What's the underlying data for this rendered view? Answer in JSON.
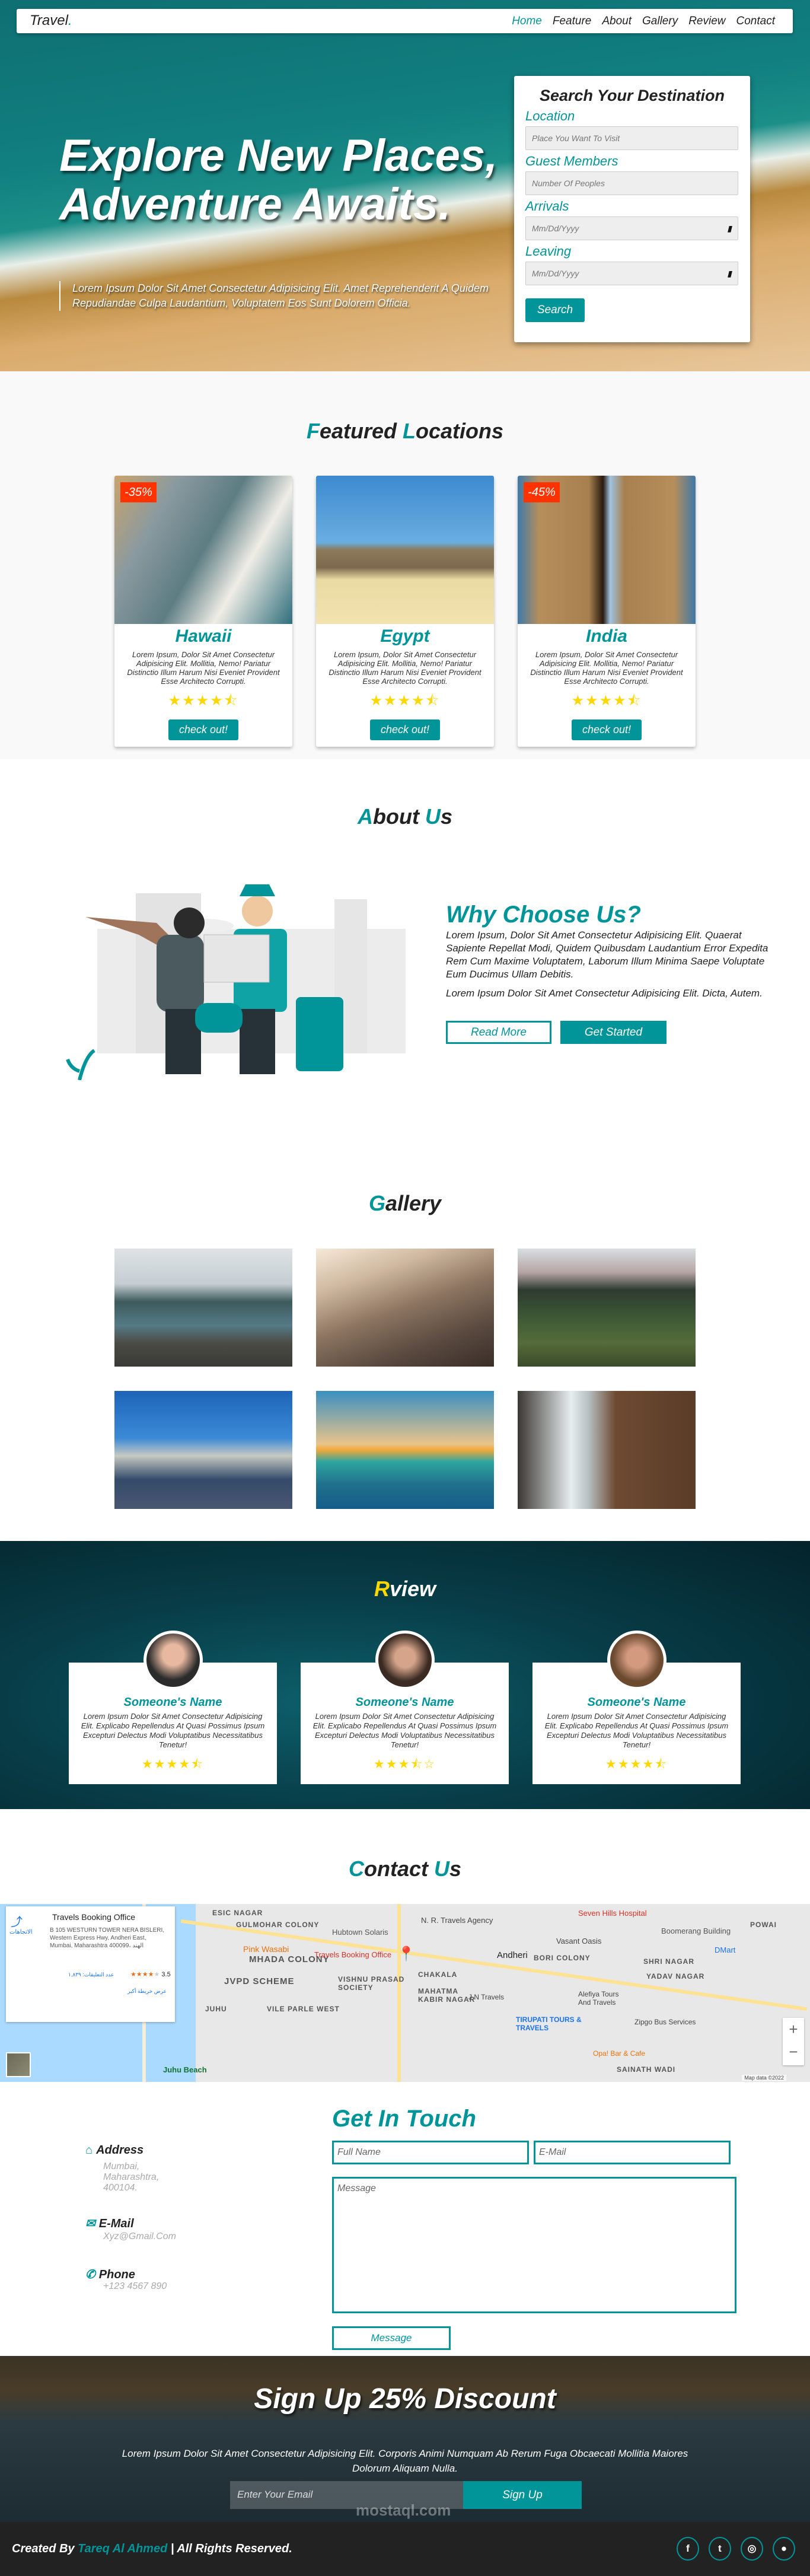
{
  "colors": {
    "accent": "#01959a",
    "badge": "#ff3300",
    "star": "#ffd700",
    "footer": "#222222"
  },
  "nav": {
    "logo": "Travel",
    "logo_dot": ".",
    "links": [
      "Home",
      "Feature",
      "About",
      "Gallery",
      "Review",
      "Contact"
    ],
    "active": "Home"
  },
  "hero": {
    "heading_line1": "Explore New Places,",
    "heading_line2": "Adventure Awaits.",
    "paragraph": "Lorem Ipsum Dolor Sit Amet Consectetur Adipisicing Elit. Amet Reprehenderit A Quidem Repudiandae Culpa Laudantium, Voluptatem Eos Sunt Dolorem Officia."
  },
  "search": {
    "title": "Search Your Destination",
    "location_label": "Location",
    "location_placeholder": "Place You Want To Visit",
    "guests_label": "Guest Members",
    "guests_placeholder": "Number Of Peoples",
    "arrivals_label": "Arrivals",
    "arrivals_placeholder": "Mm/Dd/Yyyy",
    "leaving_label": "Leaving",
    "leaving_placeholder": "Mm/Dd/Yyyy",
    "button": "Search"
  },
  "featured": {
    "title_first": "F",
    "title_rest": "eatured ",
    "title_first2": "L",
    "title_rest2": "ocations",
    "cards": [
      {
        "name": "Hawaii",
        "badge": "-35%",
        "desc": "Lorem Ipsum, Dolor Sit Amet Consectetur Adipisicing Elit. Mollitia, Nemo! Pariatur Distinctio Illum Harum Nisi Eveniet Provident Esse Architecto Corrupti.",
        "rating": 4.5,
        "button": "check out!"
      },
      {
        "name": "Egypt",
        "badge": "",
        "desc": "Lorem Ipsum, Dolor Sit Amet Consectetur Adipisicing Elit. Mollitia, Nemo! Pariatur Distinctio Illum Harum Nisi Eveniet Provident Esse Architecto Corrupti.",
        "rating": 4.5,
        "button": "check out!"
      },
      {
        "name": "India",
        "badge": "-45%",
        "desc": "Lorem Ipsum, Dolor Sit Amet Consectetur Adipisicing Elit. Mollitia, Nemo! Pariatur Distinctio Illum Harum Nisi Eveniet Provident Esse Architecto Corrupti.",
        "rating": 4.5,
        "button": "check out!"
      }
    ]
  },
  "about": {
    "title_first": "A",
    "title_rest": "bout ",
    "title_first2": "U",
    "title_rest2": "s",
    "heading": "Why Choose Us?",
    "para1": "Lorem Ipsum, Dolor Sit Amet Consectetur Adipisicing Elit. Quaerat Sapiente Repellat Modi, Quidem Quibusdam Laudantium Error Expedita Rem Cum Maxime Voluptatem, Laborum Illum Minima Saepe Voluptate Eum Ducimus Ullam Debitis.",
    "para2": "Lorem Ipsum Dolor Sit Amet Consectetur Adipisicing Elit. Dicta, Autem.",
    "read_more": "Read More",
    "get_started": "Get Started"
  },
  "gallery": {
    "title_first": "G",
    "title_rest": "allery"
  },
  "review": {
    "title_first": "R",
    "title_rest": "view",
    "items": [
      {
        "name": "Someone's Name",
        "text": "Lorem Ipsum Dolor Sit Amet Consectetur Adipisicing Elit. Explicabo Repellendus At Quasi Possimus Ipsum Excepturi Delectus Modi Voluptatibus Necessitatibus Tenetur!",
        "rating": 4.5
      },
      {
        "name": "Someone's Name",
        "text": "Lorem Ipsum Dolor Sit Amet Consectetur Adipisicing Elit. Explicabo Repellendus At Quasi Possimus Ipsum Excepturi Delectus Modi Voluptatibus Necessitatibus Tenetur!",
        "rating": 3.5
      },
      {
        "name": "Someone's Name",
        "text": "Lorem Ipsum Dolor Sit Amet Consectetur Adipisicing Elit. Explicabo Repellendus At Quasi Possimus Ipsum Excepturi Delectus Modi Voluptatibus Necessitatibus Tenetur!",
        "rating": 4.5
      }
    ]
  },
  "contact": {
    "title_first": "C",
    "title_rest": "ontact ",
    "title_first2": "U",
    "title_rest2": "s",
    "map": {
      "place": "Travels Booking Office",
      "address": "B 105 WESTURN TOWER NERA BISLERI, Western Express Hwy, Andheri East, Mumbai, Maharashtra 400099، الهند",
      "rating": "3.5",
      "reviews": "عدد التعليقات: ١,٨٣٩",
      "directions": "الاتجاهات",
      "larger_map": "عرض خريطة أكبر",
      "attribution": "Map data ©2022",
      "labels": [
        "ESIC NAGAR",
        "GULMOHAR COLONY",
        "MHADA COLONY",
        "JVPD SCHEME",
        "JUHU",
        "VILE PARLE WEST",
        "Pink Wasabi",
        "Juhu Beach",
        "Andheri",
        "BORI COLONY",
        "Seven Hills Hospital",
        "N. R. Travels Agency",
        "Vasant Oasis",
        "Boomerang Building",
        "POWAI",
        "DMart",
        "SHRI NAGAR",
        "YADAV NAGAR",
        "MAHATMA KABIR NAGAR",
        "TIRUPATI TOURS & TRAVELS",
        "Zipgo Bus Services",
        "Opa! Bar & Cafe",
        "SAINATH WADI",
        "VISHNU PRASAD SOCIETY",
        "Travels Booking Office",
        "J.N Travels",
        "Alefiya Tours And Travels",
        "CHAKALA",
        "Hubtown Solaris"
      ]
    },
    "get_in_touch": "Get In Touch",
    "address_label": "Address",
    "address_lines": [
      "Mumbai,",
      "Maharashtra,",
      "400104."
    ],
    "email_label": "E-Mail",
    "email_value": "Xyz@Gmail.Com",
    "phone_label": "Phone",
    "phone_value": "+123 4567 890",
    "fullname_placeholder": "Full Name",
    "email_placeholder": "E-Mail",
    "message_placeholder": "Message",
    "submit": "Message"
  },
  "signup": {
    "title": "Sign Up 25% Discount",
    "paragraph": "Lorem Ipsum Dolor Sit Amet Consectetur Adipisicing Elit. Corporis Animi Numquam Ab Rerum Fuga Obcaecati Mollitia Maiores Dolorum Aliquam Nulla.",
    "email_placeholder": "Enter Your Email",
    "button": "Sign Up",
    "watermark": "mostaql.com"
  },
  "footer": {
    "created_by": "Created By ",
    "author": "Tareq Al Ahmed",
    "rights": " | All Rights Reserved.",
    "social": [
      "facebook",
      "twitter",
      "instagram",
      "github"
    ]
  }
}
